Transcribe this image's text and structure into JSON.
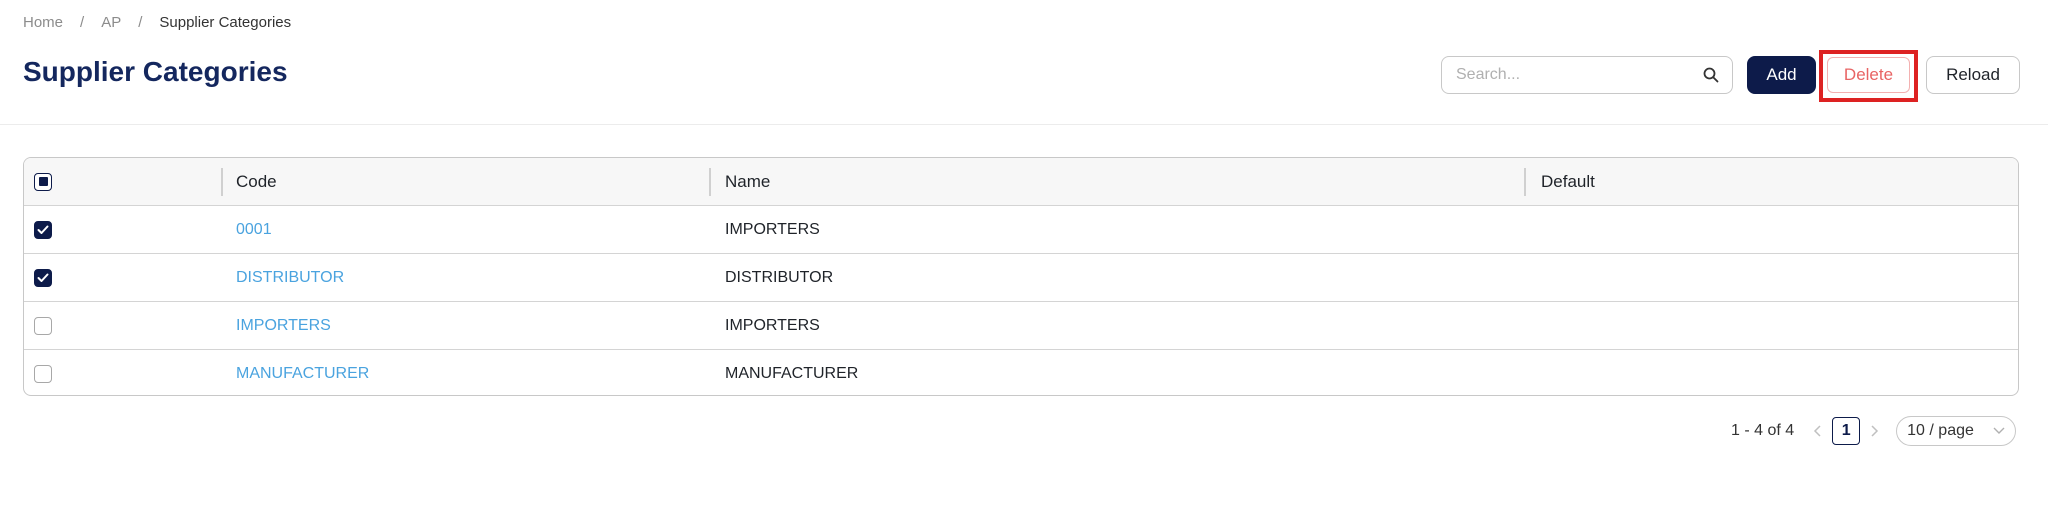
{
  "breadcrumb": [
    "Home",
    "AP",
    "Supplier Categories"
  ],
  "page": {
    "title": "Supplier Categories"
  },
  "search": {
    "placeholder": "Search..."
  },
  "toolbar": {
    "add_label": "Add",
    "delete_label": "Delete",
    "reload_label": "Reload"
  },
  "table": {
    "headers": {
      "code": "Code",
      "name": "Name",
      "default": "Default"
    },
    "rows": [
      {
        "code": "0001",
        "name": "IMPORTERS",
        "default": "",
        "checked": true
      },
      {
        "code": "DISTRIBUTOR",
        "name": "DISTRIBUTOR",
        "default": "",
        "checked": true
      },
      {
        "code": "IMPORTERS",
        "name": "IMPORTERS",
        "default": "",
        "checked": false
      },
      {
        "code": "MANUFACTURER",
        "name": "MANUFACTURER",
        "default": "",
        "checked": false
      }
    ]
  },
  "pagination": {
    "range_text": "1 - 4 of 4",
    "current_page": "1",
    "page_size": "10 / page"
  },
  "colors": {
    "primary": "#0d1b4a",
    "title": "#14275e",
    "link": "#4aa3df",
    "danger": "#e86464",
    "highlight": "#dd2222"
  },
  "icons": {
    "search": "search-icon",
    "prev": "chevron-left-icon",
    "next": "chevron-right-icon",
    "dropdown": "chevron-down-icon",
    "check": "check-icon"
  }
}
